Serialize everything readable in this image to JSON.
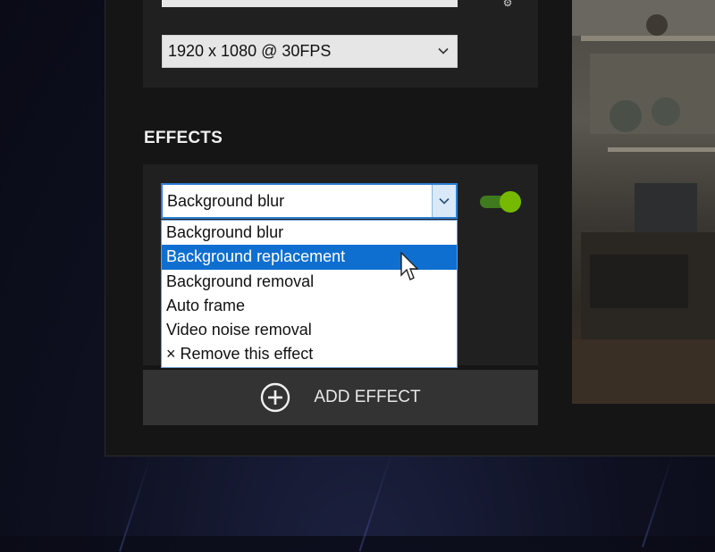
{
  "source_settings": {
    "resolution_value": "1920 x 1080 @ 30FPS",
    "gear_icon": "gear-icon"
  },
  "effects": {
    "section_title": "EFFECTS",
    "selected_effect": "Background blur",
    "toggle_on": true,
    "toggle_color": "#76b900",
    "options": [
      {
        "label": "Background blur",
        "highlighted": false
      },
      {
        "label": "Background replacement",
        "highlighted": true
      },
      {
        "label": "Background removal",
        "highlighted": false
      },
      {
        "label": "Auto frame",
        "highlighted": false
      },
      {
        "label": "Video noise removal",
        "highlighted": false
      },
      {
        "label": "× Remove this effect",
        "highlighted": false
      }
    ],
    "add_effect_label": "ADD EFFECT",
    "add_effect_icon": "plus-circle-icon"
  },
  "colors": {
    "accent": "#0f6fd1",
    "toggle": "#76b900",
    "panel": "#202020"
  }
}
